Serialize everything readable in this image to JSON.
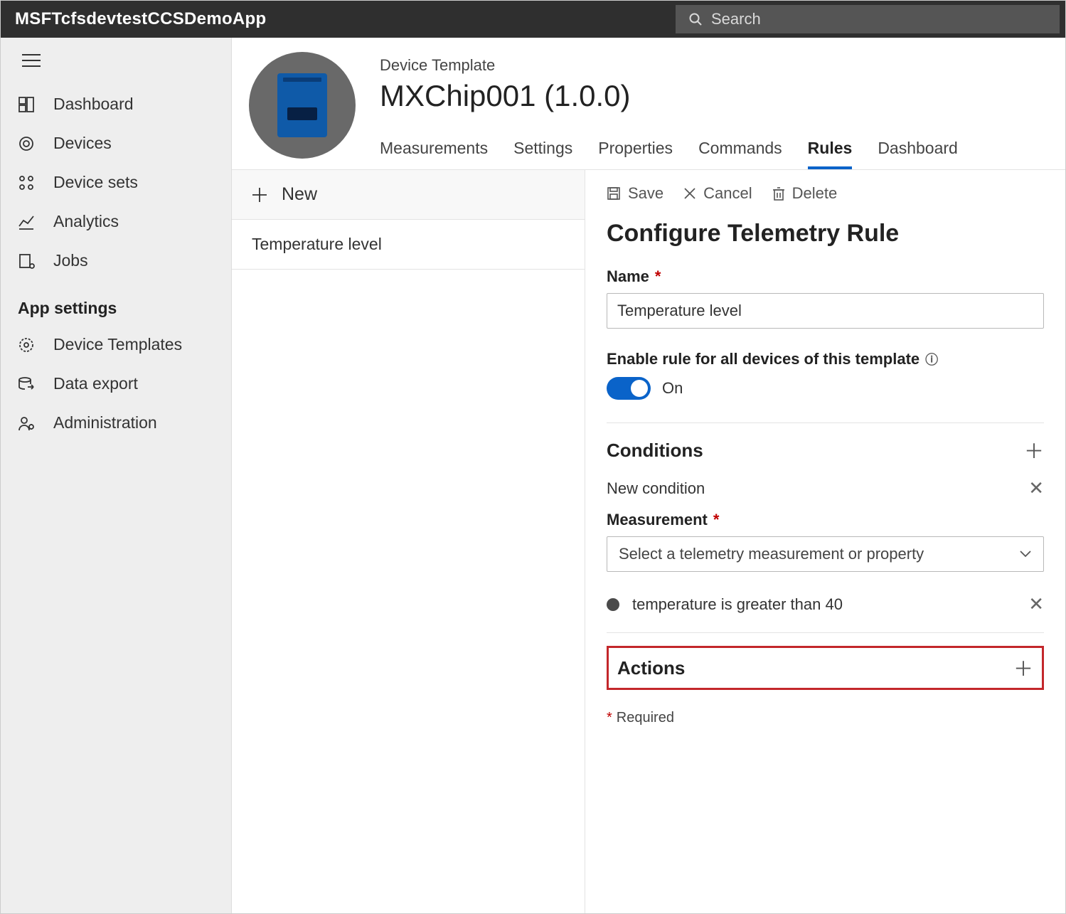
{
  "appName": "MSFTcfsdevtestCCSDemoApp",
  "search": {
    "placeholder": "Search"
  },
  "sidebar": {
    "items": [
      {
        "label": "Dashboard"
      },
      {
        "label": "Devices"
      },
      {
        "label": "Device sets"
      },
      {
        "label": "Analytics"
      },
      {
        "label": "Jobs"
      }
    ],
    "section": "App settings",
    "settings": [
      {
        "label": "Device Templates"
      },
      {
        "label": "Data export"
      },
      {
        "label": "Administration"
      }
    ]
  },
  "header": {
    "subtitle": "Device Template",
    "title": "MXChip001  (1.0.0)",
    "tabs": [
      {
        "label": "Measurements"
      },
      {
        "label": "Settings"
      },
      {
        "label": "Properties"
      },
      {
        "label": "Commands"
      },
      {
        "label": "Rules"
      },
      {
        "label": "Dashboard"
      }
    ],
    "activeTab": "Rules"
  },
  "rulesList": {
    "newLabel": "New",
    "items": [
      {
        "label": "Temperature level"
      }
    ]
  },
  "config": {
    "commands": {
      "save": "Save",
      "cancel": "Cancel",
      "delete": "Delete"
    },
    "title": "Configure Telemetry Rule",
    "name": {
      "label": "Name",
      "value": "Temperature level"
    },
    "enable": {
      "label": "Enable rule for all devices of this template",
      "state": "On"
    },
    "conditions": {
      "heading": "Conditions",
      "newLabel": "New condition",
      "measurement": {
        "label": "Measurement",
        "placeholder": "Select a telemetry measurement or property"
      },
      "existing": [
        {
          "summary": "temperature is greater than 40"
        }
      ]
    },
    "actions": {
      "heading": "Actions"
    },
    "requiredNote": "Required"
  }
}
